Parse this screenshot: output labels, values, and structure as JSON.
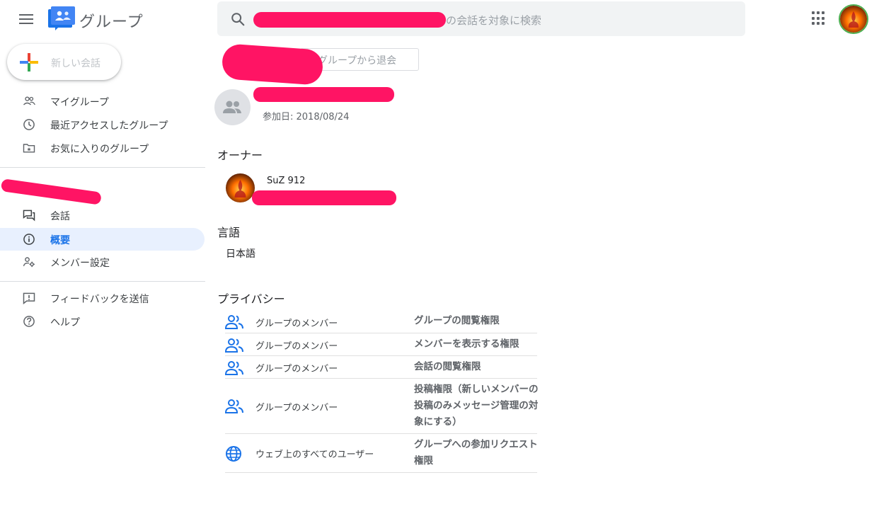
{
  "header": {
    "app_title": "グループ",
    "search_placeholder": "の会話を対象に検索"
  },
  "sidebar": {
    "new_conversation_label": "新しい会話",
    "top_items": [
      {
        "label": "マイグループ",
        "icon": "people-icon"
      },
      {
        "label": "最近アクセスしたグループ",
        "icon": "clock-icon"
      },
      {
        "label": "お気に入りのグループ",
        "icon": "star-folder-icon"
      }
    ],
    "group_items": [
      {
        "label": "会話",
        "icon": "forum-icon"
      },
      {
        "label": "概要",
        "icon": "info-icon",
        "active": true
      },
      {
        "label": "メンバー設定",
        "icon": "member-settings-icon"
      }
    ],
    "bottom_items": [
      {
        "label": "フィードバックを送信",
        "icon": "feedback-icon"
      },
      {
        "label": "ヘルプ",
        "icon": "help-icon"
      }
    ]
  },
  "main": {
    "leave_group_label": "グループから退会",
    "joined_date": "参加日: 2018/08/24",
    "owner_section_title": "オーナー",
    "owner_name": "SuZ 912",
    "language_section_title": "言語",
    "language_value": "日本語",
    "privacy_section_title": "プライバシー",
    "privacy_rows": [
      {
        "who": "グループのメンバー",
        "permission": "グループの閲覧権限",
        "icon": "group-icon"
      },
      {
        "who": "グループのメンバー",
        "permission": "メンバーを表示する権限",
        "icon": "group-icon"
      },
      {
        "who": "グループのメンバー",
        "permission": "会話の閲覧権限",
        "icon": "group-icon"
      },
      {
        "who": "グループのメンバー",
        "permission": "投稿権限（新しいメンバーの投稿のみメッセージ管理の対象にする）",
        "icon": "group-icon"
      },
      {
        "who": "ウェブ上のすべてのユーザー",
        "permission": "グループへの参加リクエスト権限",
        "icon": "globe-icon"
      }
    ]
  },
  "colors": {
    "accent": "#1a73e8",
    "redaction": "#ff1464",
    "active_bg": "#e8f0fe"
  }
}
